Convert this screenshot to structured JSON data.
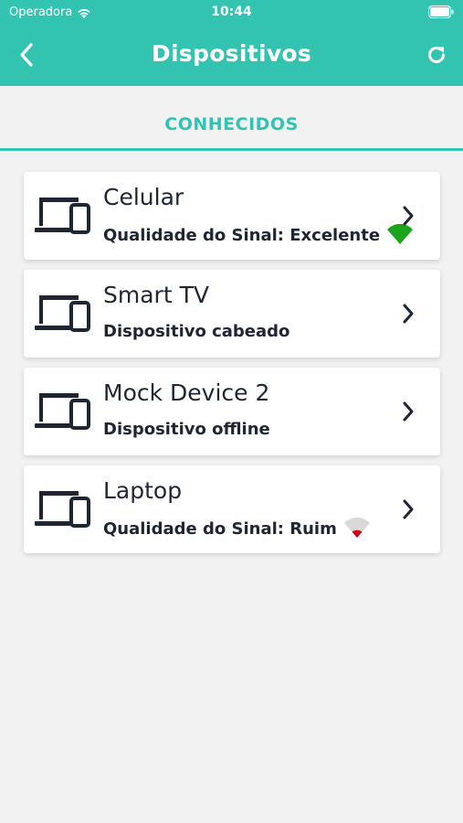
{
  "status_bar": {
    "carrier": "Operadora",
    "time": "10:44"
  },
  "header": {
    "title": "Dispositivos",
    "back_icon": "chevron-left-icon",
    "refresh_icon": "refresh-icon",
    "background": "#33c3b1"
  },
  "tabs": [
    {
      "label": "CONHECIDOS",
      "active": true
    }
  ],
  "devices": [
    {
      "name": "Celular",
      "subtitle": "Qualidade do Sinal: Excelente",
      "signal": "excellent",
      "signal_color": "#1aa51a"
    },
    {
      "name": "Smart TV",
      "subtitle": "Dispositivo cabeado",
      "signal": "none"
    },
    {
      "name": "Mock Device 2",
      "subtitle": "Dispositivo offline",
      "signal": "none"
    },
    {
      "name": "Laptop",
      "subtitle": "Qualidade do Sinal: Ruim",
      "signal": "poor",
      "signal_color": "#d0021b"
    }
  ],
  "colors": {
    "accent": "#33c3b1",
    "text_dark": "#1f2533",
    "background": "#f2f2f2"
  }
}
